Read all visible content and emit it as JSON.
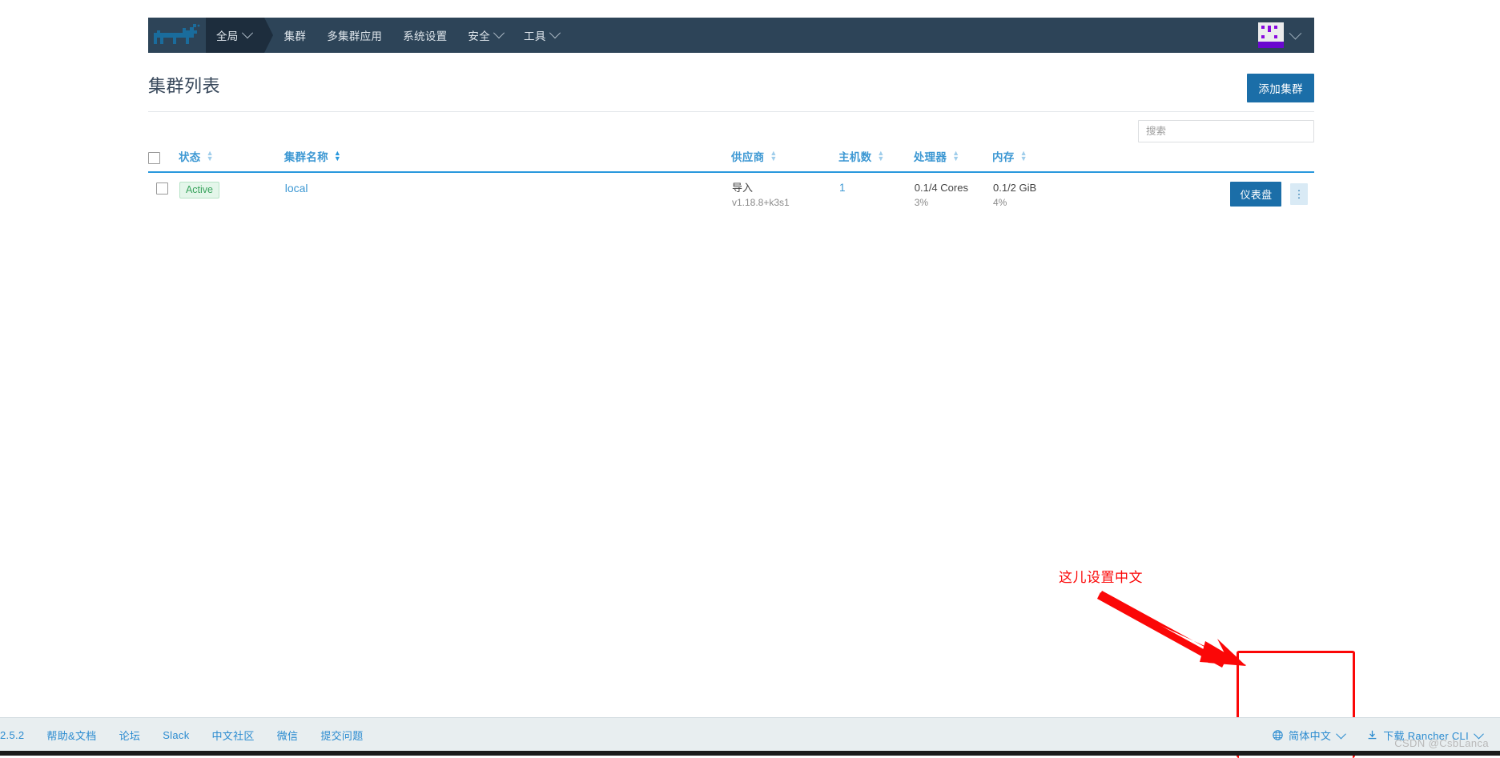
{
  "navbar": {
    "logo_name": "rancher-logo",
    "items": [
      {
        "label": "全局",
        "has_caret": true,
        "active": true,
        "name": "nav-global"
      },
      {
        "label": "集群",
        "has_caret": false,
        "active": false,
        "name": "nav-clusters"
      },
      {
        "label": "多集群应用",
        "has_caret": false,
        "active": false,
        "name": "nav-multi-cluster-apps"
      },
      {
        "label": "系统设置",
        "has_caret": false,
        "active": false,
        "name": "nav-settings"
      },
      {
        "label": "安全",
        "has_caret": true,
        "active": false,
        "name": "nav-security"
      },
      {
        "label": "工具",
        "has_caret": true,
        "active": false,
        "name": "nav-tools"
      }
    ],
    "user_avatar_alt": "user-avatar"
  },
  "header": {
    "title": "集群列表",
    "add_cluster_label": "添加集群"
  },
  "search": {
    "placeholder": "搜索",
    "value": ""
  },
  "table": {
    "columns": [
      {
        "label": "状态",
        "name": "col-state",
        "sortable": true,
        "sorted": false
      },
      {
        "label": "集群名称",
        "name": "col-name",
        "sortable": true,
        "sorted": true
      },
      {
        "label": "供应商",
        "name": "col-provider",
        "sortable": true,
        "sorted": false
      },
      {
        "label": "主机数",
        "name": "col-nodes",
        "sortable": true,
        "sorted": false
      },
      {
        "label": "处理器",
        "name": "col-cpu",
        "sortable": true,
        "sorted": false
      },
      {
        "label": "内存",
        "name": "col-memory",
        "sortable": true,
        "sorted": false
      }
    ],
    "rows": [
      {
        "state": "Active",
        "name": "local",
        "provider": "导入",
        "provider_version": "v1.18.8+k3s1",
        "nodes": "1",
        "cpu": "0.1/4 Cores",
        "cpu_pct": "3%",
        "memory": "0.1/2 GiB",
        "memory_pct": "4%",
        "dashboard_label": "仪表盘",
        "kebab_label": "⋮"
      }
    ]
  },
  "annotation": {
    "text": "这儿设置中文",
    "color": "#fb0707"
  },
  "footer": {
    "version": "2.5.2",
    "links": [
      "帮助&文档",
      "论坛",
      "Slack",
      "中文社区",
      "微信",
      "提交问题"
    ],
    "language_label": "简体中文",
    "download_label": "下载 Rancher CLI",
    "watermark": "CSDN @CsbLanca"
  },
  "colors": {
    "nav_bg": "#2d4458",
    "nav_active_bg": "#1d2d3d",
    "primary": "#1b6ea8",
    "link": "#3d98d3",
    "header_underline": "#2998dd",
    "success": "#3aa45e",
    "annotation": "#fb0707",
    "footer_bg": "#e8eef0"
  }
}
